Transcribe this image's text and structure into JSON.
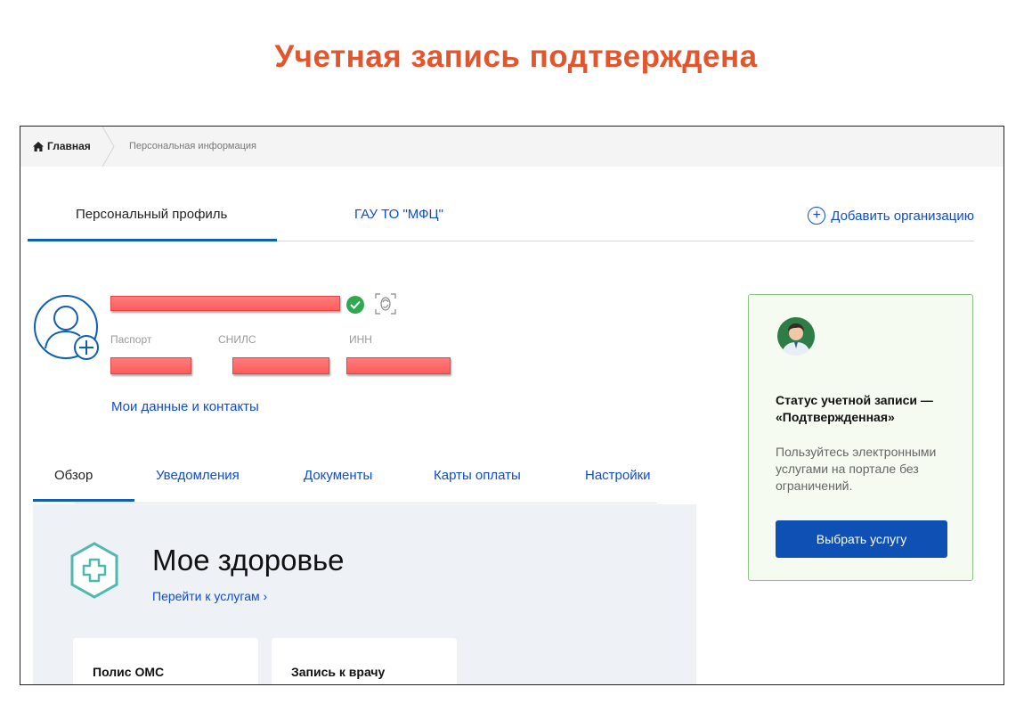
{
  "slide": {
    "title": "Учетная запись подтверждена"
  },
  "colors": {
    "title": "#e2552d",
    "link": "#0d4cd3",
    "accent_underline": "#0f5fb3",
    "teal_icon": "#4fb8b0",
    "check_green": "#2fa84f",
    "button": "#0f50b4"
  },
  "breadcrumb": {
    "home_icon": "home-icon",
    "home": "Главная",
    "current": "Персональная информация"
  },
  "top_tabs": {
    "items": [
      "Персональный профиль",
      "ГАУ ТО \"МФЦ\""
    ],
    "active": 0,
    "add_org_icon": "plus-circle-icon",
    "add_org": "Добавить организацию"
  },
  "profile": {
    "avatar_icon": "user-add-icon",
    "verified_icon": "check-circle-icon",
    "biometry_icon": "fingerprint-icon",
    "doc_labels": [
      "Паспорт",
      "СНИЛС",
      "ИНН"
    ],
    "my_data_link": "Мои данные и контакты"
  },
  "sub_tabs": {
    "items": [
      "Обзор",
      "Уведомления",
      "Документы",
      "Карты оплаты",
      "Настройки"
    ],
    "active": 0
  },
  "health": {
    "icon": "medical-cross-icon",
    "title": "Мое здоровье",
    "link": "Перейти к услугам",
    "link_chevron": "›",
    "cards": [
      "Полис ОМС",
      "Запись к врачу"
    ]
  },
  "status": {
    "avatar_icon": "doctor-avatar-icon",
    "title": "Статус учетной записи — «Подтвержденная»",
    "description": "Пользуйтесь электронными услугами на портале без ограничений.",
    "button": "Выбрать услугу"
  }
}
